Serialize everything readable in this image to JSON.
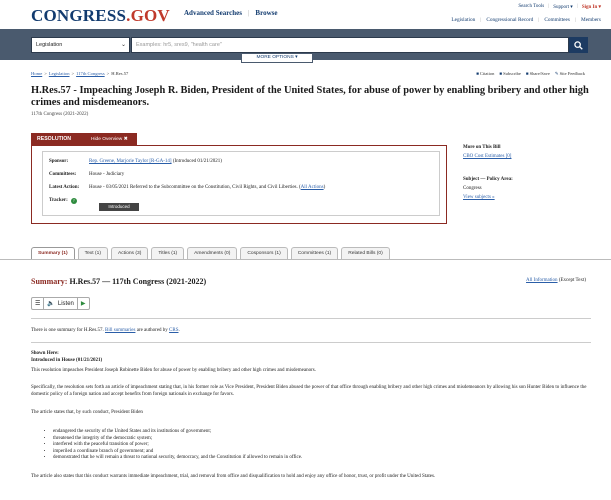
{
  "header": {
    "logo_text": "CONGRESS",
    "logo_dot": ".",
    "logo_gov": "GOV",
    "main_nav": [
      "Advanced Searches",
      "Browse"
    ],
    "util_nav": [
      "Search Tools",
      "Support ▾",
      "Sign In ▾"
    ],
    "sub_nav": [
      "Legislation",
      "Congressional Record",
      "Committees",
      "Members"
    ]
  },
  "search": {
    "scope": "Legislation",
    "placeholder": "Examples: hr5, sres9, \"health care\"",
    "more_options": "MORE OPTIONS ▾"
  },
  "breadcrumb": [
    "Home",
    ">",
    "Legislation",
    ">",
    "117th Congress",
    ">",
    "H.Res.57"
  ],
  "actions": [
    {
      "icon": "citation-icon",
      "label": "Citation"
    },
    {
      "icon": "subscribe-icon",
      "label": "Subscribe"
    },
    {
      "icon": "share-icon",
      "label": "Share/Save"
    },
    {
      "icon": "feedback-icon",
      "label": "Site Feedback"
    }
  ],
  "bill": {
    "title": "H.Res.57 - Impeaching Joseph R. Biden, President of the United States, for abuse of power by enabling bribery and other high crimes and misdemeanors.",
    "congress": "117th Congress (2021-2022)"
  },
  "overview": {
    "tab_label": "RESOLUTION",
    "hide_label": "Hide Overview",
    "sponsor_label": "Sponsor:",
    "sponsor_link": "Rep. Greene, Marjorie Taylor [R-GA-14]",
    "sponsor_intro": " (Introduced 01/21/2021)",
    "committees_label": "Committees:",
    "committees_value": "House - Judiciary",
    "latest_action_label": "Latest Action:",
    "latest_action_value": "House - 03/05/2021 Referred to the Subcommittee on the Constitution, Civil Rights, and Civil Liberties.",
    "all_actions_link": "All Actions",
    "tracker_label": "Tracker:",
    "tracker_stage": "Introduced"
  },
  "side": {
    "more_heading": "More on This Bill",
    "cbo_link": "CBO Cost Estimates [0]",
    "subject_heading": "Subject — Policy Area:",
    "subject_value": "Congress",
    "view_subjects": "View subjects »"
  },
  "tabs": [
    "Summary (1)",
    "Text (1)",
    "Actions (3)",
    "Titles (1)",
    "Amendments (0)",
    "Cosponsors (1)",
    "Committees (1)",
    "Related Bills (0)"
  ],
  "summary": {
    "label": "Summary:",
    "title": "H.Res.57 — 117th Congress (2021-2022)",
    "all_info_link": "All Information",
    "all_info_suffix": " (Except Text)",
    "listen_label": "Listen",
    "one_summary_prefix": "There is one summary for H.Res.57. ",
    "bill_summaries_link": "Bill summaries",
    "authored_by": " are authored by ",
    "crs_link": "CRS",
    "shown_here": "Shown Here:",
    "introduced_heading": "Introduced in House (01/21/2021)",
    "para1": "This resolution impeaches President Joseph Robinette Biden for abuse of power by enabling bribery and other high crimes and misdemeanors.",
    "para2": "Specifically, the resolution sets forth an article of impeachment stating that, in his former role as Vice President, President Biden abused the power of that office through enabling bribery and other high crimes and misdemeanors by allowing his son Hunter Biden to influence the domestic policy of a foreign nation and accept benefits from foreign nationals in exchange for favors.",
    "para3": "The article states that, by such conduct, President Biden",
    "bullets": [
      "endangered the security of the United States and its institutions of government;",
      "threatened the integrity of the democratic system;",
      "interfered with the peaceful transition of power;",
      "imperiled a coordinate branch of government; and",
      "demonstrated that he will remain a threat to national security, democracy, and the Constitution if allowed to remain in office."
    ],
    "para4": "The article also states that this conduct warrants immediate impeachment, trial, and removal from office and disqualification to hold and enjoy any office of honor, trust, or profit under the United States."
  }
}
